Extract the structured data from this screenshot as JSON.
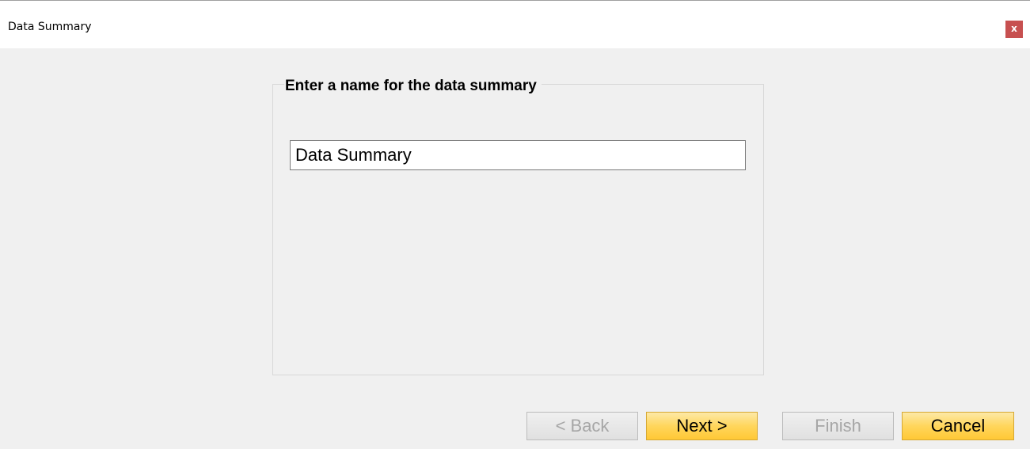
{
  "window": {
    "title": "Data Summary",
    "close_label": "x"
  },
  "group": {
    "legend": "Enter a name for the data summary"
  },
  "name_field": {
    "value": "Data Summary"
  },
  "buttons": {
    "back": "< Back",
    "next": "Next >",
    "finish": "Finish",
    "cancel": "Cancel"
  },
  "colors": {
    "close_button": "#c75050",
    "active_button": "#ffd65c",
    "background": "#f0f0f0"
  }
}
